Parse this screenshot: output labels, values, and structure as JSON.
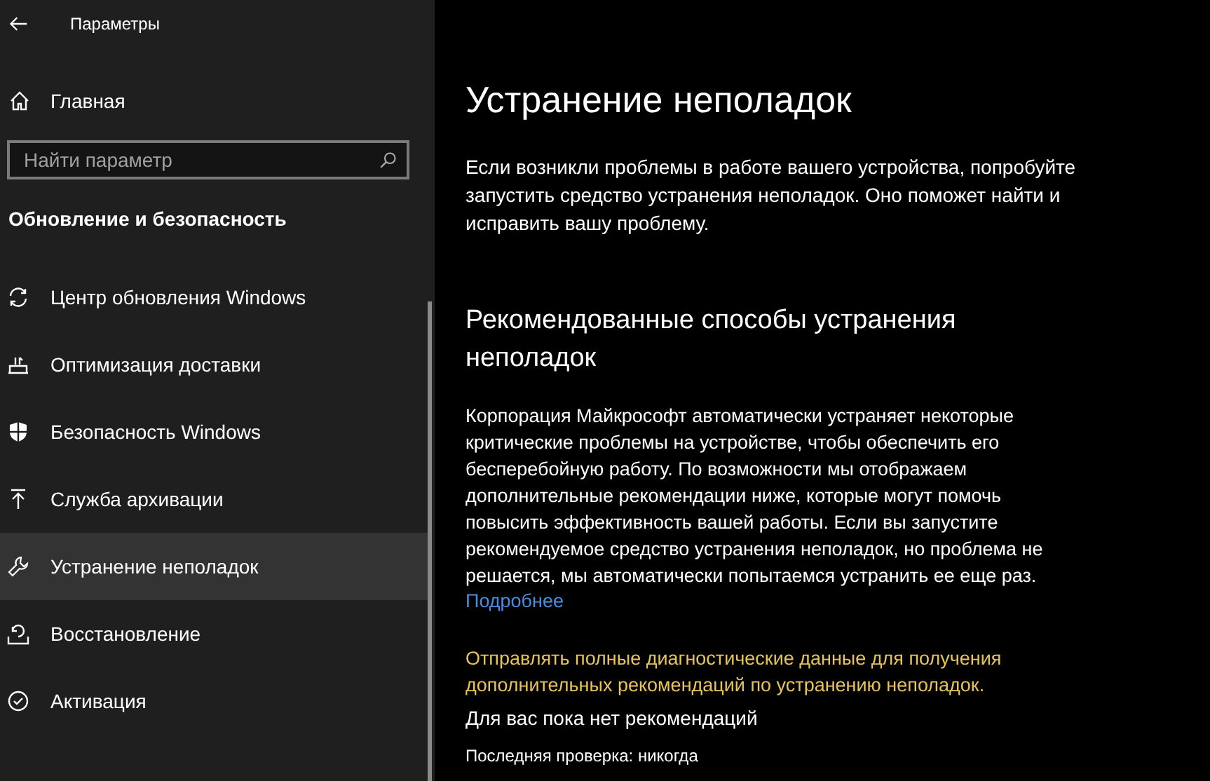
{
  "window": {
    "title": "Параметры"
  },
  "sidebar": {
    "home": "Главная",
    "search": {
      "placeholder": "Найти параметр"
    },
    "section": "Обновление и безопасность",
    "items": [
      {
        "kind": "sync",
        "label": "Центр обновления Windows",
        "selected": false
      },
      {
        "kind": "delivery",
        "label": "Оптимизация доставки",
        "selected": false
      },
      {
        "kind": "shield",
        "label": "Безопасность Windows",
        "selected": false
      },
      {
        "kind": "backup",
        "label": "Служба архивации",
        "selected": false
      },
      {
        "kind": "wrench",
        "label": "Устранение неполадок",
        "selected": true
      },
      {
        "kind": "recovery",
        "label": "Восстановление",
        "selected": false
      },
      {
        "kind": "activation",
        "label": "Активация",
        "selected": false
      }
    ]
  },
  "main": {
    "title": "Устранение неполадок",
    "intro": "Если возникли проблемы в работе вашего устройства, попробуйте запустить средство устранения неполадок. Оно поможет найти и исправить вашу проблему.",
    "subtitle": "Рекомендованные способы устранения неполадок",
    "body": "Корпорация Майкрософт автоматически устраняет некоторые критические проблемы на устройстве, чтобы обеспечить его бесперебойную работу. По возможности мы отображаем дополнительные рекомендации ниже, которые могут помочь повысить эффективность вашей работы. Если вы запустите рекомендуемое средство устранения неполадок, но проблема не решается, мы автоматически попытаемся устранить ее еще раз.",
    "more_link": "Подробнее",
    "diagnostics_link": "Отправлять полные диагностические данные для получения дополнительных рекомендаций по устранению неполадок.",
    "status": "Для вас пока нет рекомендаций",
    "last_check": "Последняя проверка: никогда"
  }
}
